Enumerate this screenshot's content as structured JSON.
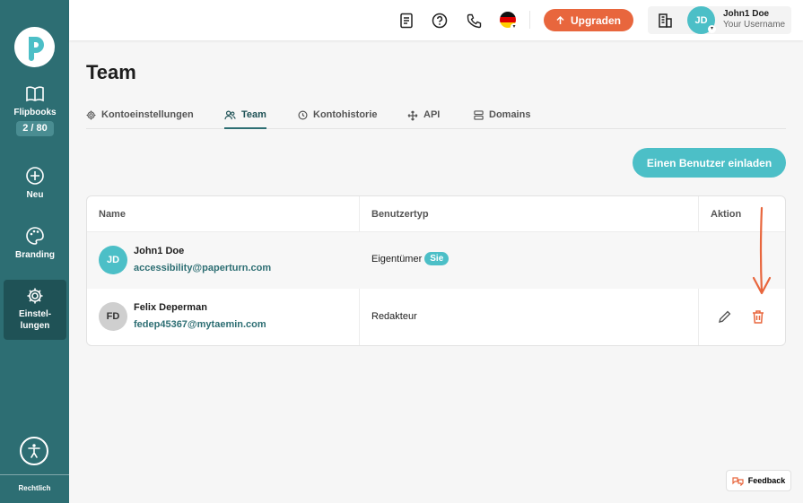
{
  "sidebar": {
    "flipbooks_label": "Flipbooks",
    "flipbooks_count": "2 / 80",
    "new_label": "Neu",
    "branding_label": "Branding",
    "settings_label_1": "Einstel-",
    "settings_label_2": "lungen",
    "legal_label": "Rechtlich"
  },
  "topbar": {
    "upgrade_label": "Upgraden",
    "user_initials": "JD",
    "user_name": "John1 Doe",
    "user_subtitle": "Your Username"
  },
  "page": {
    "title": "Team",
    "tabs": [
      {
        "label": "Kontoeinstellungen"
      },
      {
        "label": "Team"
      },
      {
        "label": "Kontohistorie"
      },
      {
        "label": "API"
      },
      {
        "label": "Domains"
      }
    ],
    "invite_label": "Einen Benutzer einladen"
  },
  "table": {
    "headers": {
      "name": "Name",
      "type": "Benutzertyp",
      "action": "Aktion"
    },
    "rows": [
      {
        "initials": "JD",
        "name": "John1 Doe",
        "email": "accessibility@paperturn.com",
        "type": "Eigentümer",
        "badge": "Sie"
      },
      {
        "initials": "FD",
        "name": "Felix Deperman",
        "email": "fedep45367@mytaemin.com",
        "type": "Redakteur"
      }
    ]
  },
  "feedback_label": "Feedback",
  "colors": {
    "sidebar": "#2d6e73",
    "accent": "#4cbfc7",
    "upgrade": "#e8663d",
    "delete": "#e8663d"
  }
}
